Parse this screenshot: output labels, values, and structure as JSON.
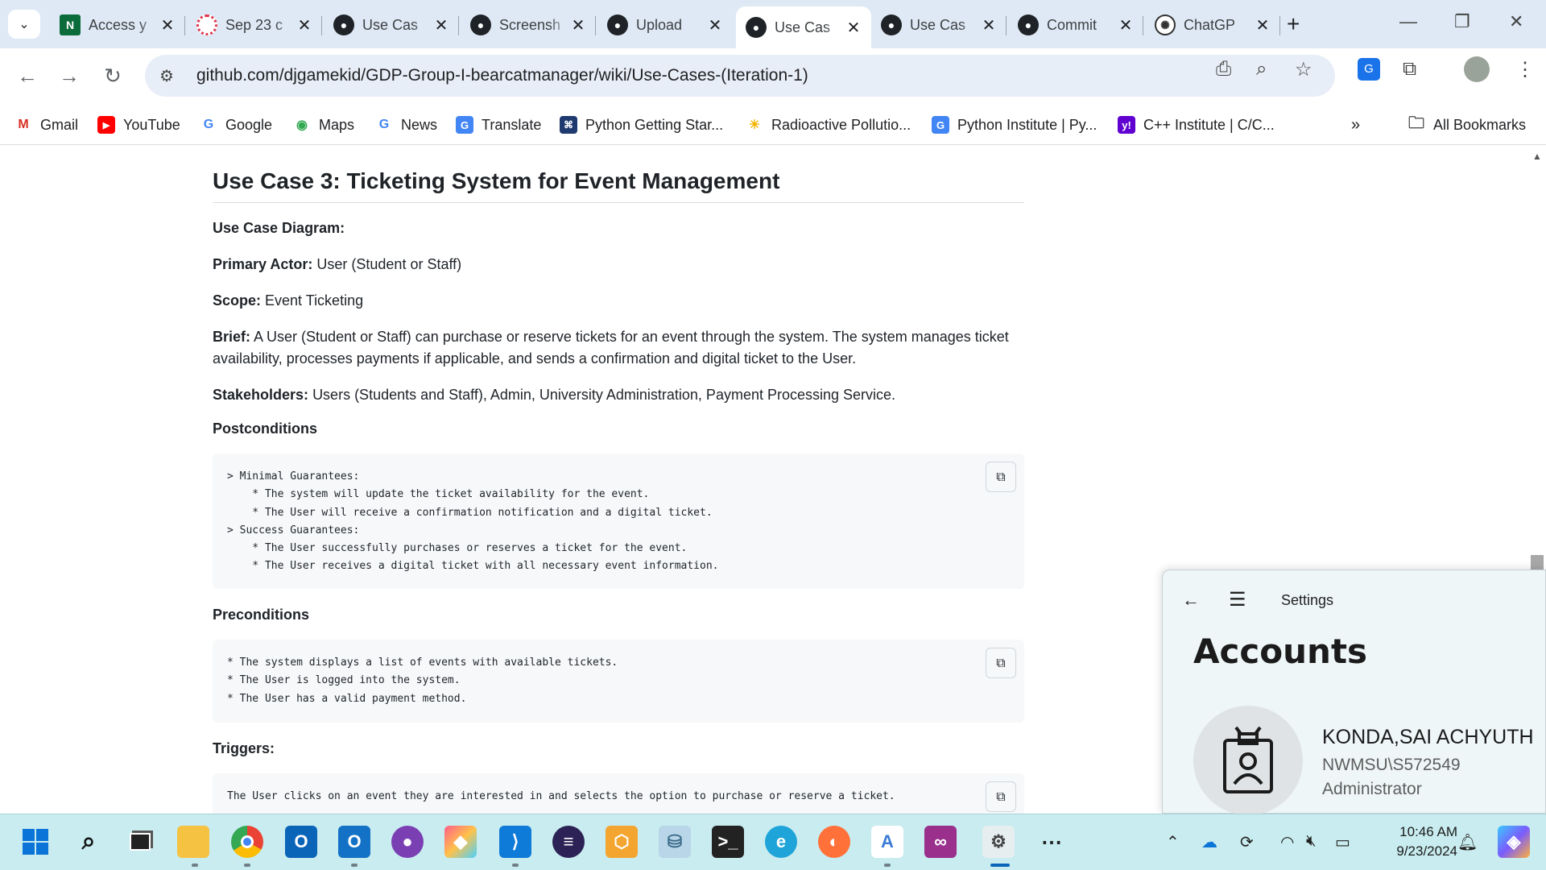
{
  "browser": {
    "tabs": [
      {
        "title": "Access y",
        "icon": "notion-n-icon",
        "active": false
      },
      {
        "title": "Sep 23 c",
        "icon": "gear-red-icon",
        "active": false
      },
      {
        "title": "Use Cas",
        "icon": "github-icon",
        "active": false
      },
      {
        "title": "Screensh",
        "icon": "github-icon",
        "active": false
      },
      {
        "title": "Upload",
        "icon": "github-icon",
        "active": false
      },
      {
        "title": "Use Cas",
        "icon": "github-icon",
        "active": true
      },
      {
        "title": "Use Cas",
        "icon": "github-icon",
        "active": false
      },
      {
        "title": "Commit",
        "icon": "github-icon",
        "active": false
      },
      {
        "title": "ChatGP",
        "icon": "chatgpt-icon",
        "active": false
      }
    ],
    "url": "github.com/djgamekid/GDP-Group-I-bearcatmanager/wiki/Use-Cases-(Iteration-1)",
    "bookmarks": [
      {
        "label": "Gmail",
        "icon": "gmail-icon"
      },
      {
        "label": "YouTube",
        "icon": "youtube-icon"
      },
      {
        "label": "Google",
        "icon": "google-icon"
      },
      {
        "label": "Maps",
        "icon": "maps-icon"
      },
      {
        "label": "News",
        "icon": "google-news-icon"
      },
      {
        "label": "Translate",
        "icon": "translate-icon"
      },
      {
        "label": "Python Getting Star...",
        "icon": "python-icon"
      },
      {
        "label": "Radioactive Pollutio...",
        "icon": "sun-icon"
      },
      {
        "label": "Python Institute | Py...",
        "icon": "translate-icon"
      },
      {
        "label": "C++ Institute | C/C...",
        "icon": "yahoo-icon"
      }
    ],
    "more_bookmarks": "»",
    "all_bookmarks": "All Bookmarks"
  },
  "page": {
    "title": "Use Case 3: Ticketing System for Event Management",
    "diagram_label": "Use Case Diagram:",
    "primary_actor_label": "Primary Actor:",
    "primary_actor": "User (Student or Staff)",
    "scope_label": "Scope:",
    "scope": "Event Ticketing",
    "brief_label": "Brief:",
    "brief": "A User (Student or Staff) can purchase or reserve tickets for an event through the system. The system manages ticket availability, processes payments if applicable, and sends a confirmation and digital ticket to the User.",
    "stakeholders_label": "Stakeholders:",
    "stakeholders": "Users (Students and Staff), Admin, University Administration, Payment Processing Service.",
    "postconditions_label": "Postconditions",
    "postconditions_code": "> Minimal Guarantees:\n    * The system will update the ticket availability for the event.\n    * The User will receive a confirmation notification and a digital ticket.\n> Success Guarantees:\n    * The User successfully purchases or reserves a ticket for the event.\n    * The User receives a digital ticket with all necessary event information.",
    "preconditions_label": "Preconditions",
    "preconditions_code": "* The system displays a list of events with available tickets.\n* The User is logged into the system.\n* The User has a valid payment method.",
    "triggers_label": "Triggers:",
    "triggers_code": "The User clicks on an event they are interested in and selects the option to purchase or reserve a ticket."
  },
  "settings": {
    "title": "Settings",
    "heading": "Accounts",
    "account_name": "KONDA,SAI ACHYUTH",
    "account_id": "NWMSU\\S572549",
    "account_role": "Administrator"
  },
  "taskbar": {
    "time": "10:46 AM",
    "date": "9/23/2024"
  },
  "colors": {
    "tabstrip": "#dfe9f5",
    "omnibox": "#e8eef7",
    "taskbar": "#c8ecef",
    "code_bg": "#f6f8fa"
  }
}
